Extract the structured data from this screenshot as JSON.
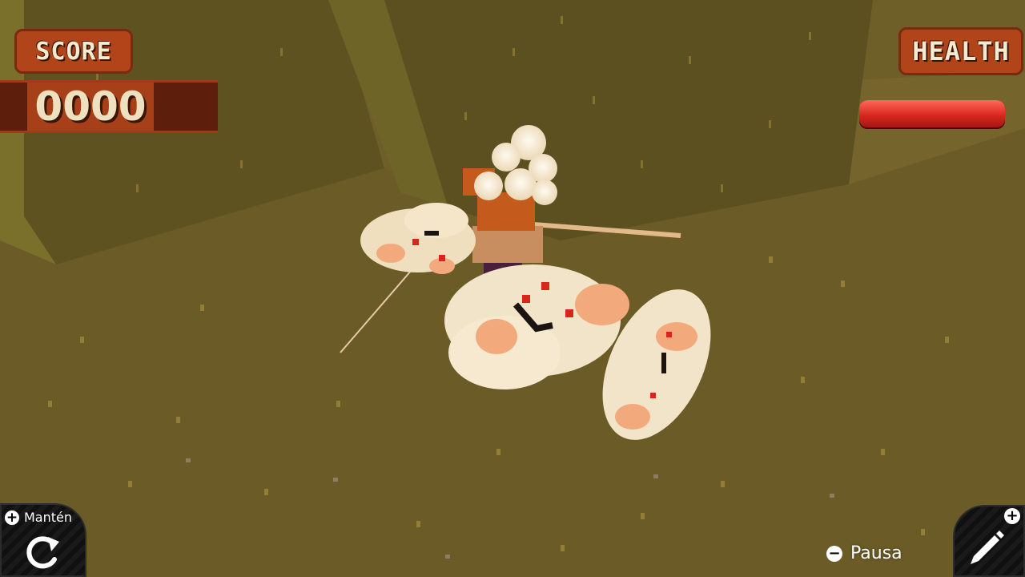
{
  "hud": {
    "score_label": "SCORE",
    "score_value": "0000",
    "health_label": "HEALTH",
    "health_level": 1.0
  },
  "controls": {
    "hold_label": "Mantén",
    "pause_label": "Pausa",
    "icons": [
      "plus-icon",
      "restart-icon",
      "minus-icon",
      "pencil-icon"
    ]
  },
  "colors": {
    "hud_orange": "#b2441a",
    "hud_dark": "#5e1e0c",
    "health_red": "#d9281f",
    "ground": "#6b5b27",
    "sky": "#f3c52f"
  }
}
